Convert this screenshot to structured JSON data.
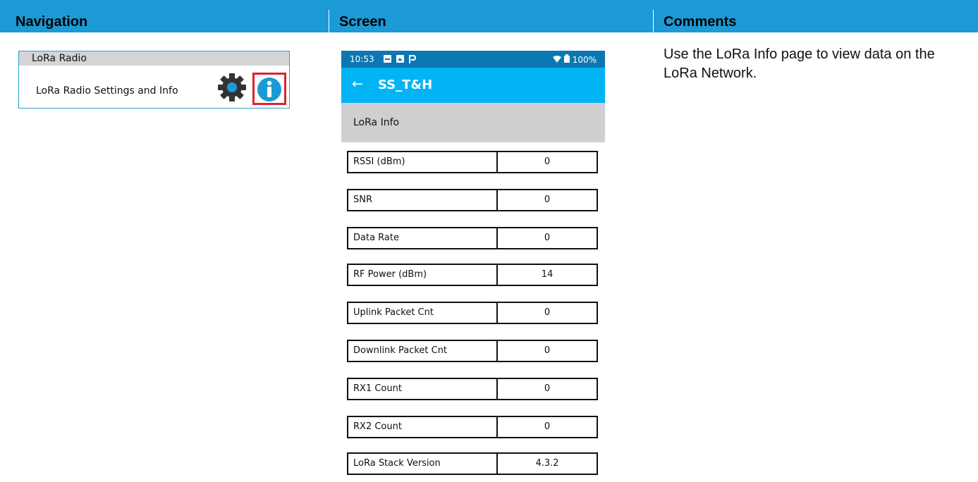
{
  "header": {
    "navigation": "Navigation",
    "screen": "Screen",
    "comments": "Comments"
  },
  "colors": {
    "header_bg": "#1b9ad6",
    "status_bar": "#0b78b2",
    "app_bar": "#00b4f5",
    "highlight_box": "#e02130",
    "info_icon": "#1b9ad6"
  },
  "nav_panel": {
    "title": "LoRa Radio",
    "item_label": "LoRa Radio Settings and Info",
    "icons": [
      "gear-icon",
      "info-icon"
    ]
  },
  "phone": {
    "status_bar": {
      "time": "10:53",
      "battery": "100%",
      "icons": [
        "notification-icon",
        "image-icon",
        "p-icon",
        "wifi-icon",
        "battery-icon"
      ]
    },
    "app_bar": {
      "back": "←",
      "title": "SS_T&H"
    },
    "section_title": "LoRa Info",
    "rows": [
      {
        "label": "RSSI (dBm)",
        "value": "0"
      },
      {
        "label": "SNR",
        "value": "0"
      },
      {
        "label": "Data Rate",
        "value": "0"
      },
      {
        "label": "RF Power (dBm)",
        "value": "14"
      },
      {
        "label": "Uplink Packet Cnt",
        "value": "0"
      },
      {
        "label": "Downlink Packet Cnt",
        "value": "0"
      },
      {
        "label": "RX1 Count",
        "value": "0"
      },
      {
        "label": "RX2 Count",
        "value": "0"
      },
      {
        "label": "LoRa Stack Version",
        "value": "4.3.2"
      }
    ]
  },
  "comment": "Use the LoRa Info page to view data on the LoRa Network."
}
